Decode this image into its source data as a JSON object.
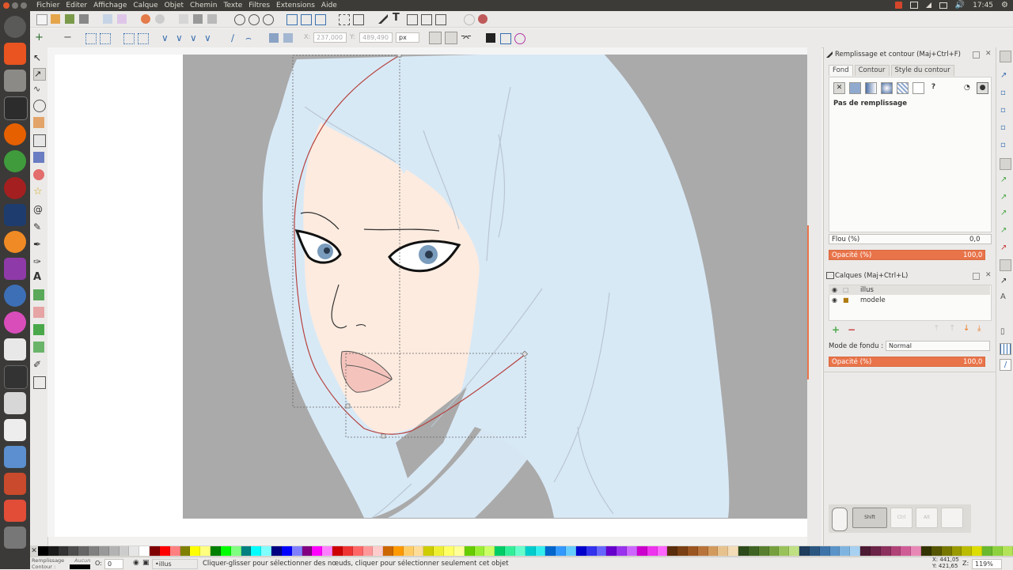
{
  "menubar": {
    "items": [
      "Fichier",
      "Editer",
      "Affichage",
      "Calque",
      "Objet",
      "Chemin",
      "Texte",
      "Filtres",
      "Extensions",
      "Aide"
    ]
  },
  "tray": {
    "time": "17:45"
  },
  "toolcontrols": {
    "x_value": "237,000",
    "y_value": "489,490",
    "unit": "px"
  },
  "fill_stroke_panel": {
    "title": "Remplissage et contour (Maj+Ctrl+F)",
    "tabs": [
      "Fond",
      "Contour",
      "Style du contour"
    ],
    "question_mark": "?",
    "status": "Pas de remplissage",
    "blur_label": "Flou (%)",
    "blur_value": "0,0",
    "opacity_label": "Opacité (%)",
    "opacity_value": "100,0"
  },
  "layers_panel": {
    "title": "Calques (Maj+Ctrl+L)",
    "layers": [
      {
        "name": "illus"
      },
      {
        "name": "modele"
      }
    ],
    "blend_label": "Mode de fondu :",
    "blend_value": "Normal",
    "opacity_label": "Opacité (%)",
    "opacity_value": "100,0"
  },
  "keys": {
    "ctrl": "Ctrl",
    "alt": "Alt",
    "shift": "Shift"
  },
  "statusbar": {
    "fill_label": "Remplissage",
    "stroke_label": "Contour :",
    "fill_value": "Aucun",
    "opacity_o": "O:",
    "opacity_num": "0",
    "layer": "•illus",
    "message": "Cliquer-glisser pour sélectionner des nœuds, cliquer pour sélectionner seulement cet objet",
    "x_coord": "X: 441,05",
    "y_coord": "Y: 421,65",
    "z_label": "Z:",
    "zoom": "119%"
  },
  "colors": {
    "accent": "#e9744a",
    "panel_bg": "#ebeae8",
    "hair": "#d8e9f6",
    "skin": "#fdebdf",
    "gray_bg": "#aaaaaa",
    "path": "#b5423e",
    "eye": "#7a9cbd",
    "lips": "#f4c4bc"
  }
}
